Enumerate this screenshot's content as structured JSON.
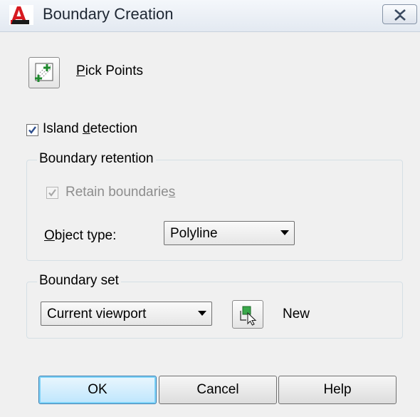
{
  "window": {
    "title": "Boundary Creation",
    "close_label": "Close"
  },
  "pick_points": {
    "label_accel": "P",
    "label_rest": "ick Points"
  },
  "island_detection": {
    "checked": true,
    "label_pre": "Island ",
    "label_accel": "d",
    "label_rest": "etection"
  },
  "boundary_retention": {
    "title": "Boundary retention",
    "retain": {
      "checked": true,
      "enabled": false,
      "label_pre": "Retain boundarie",
      "label_accel": "s"
    },
    "object_type": {
      "label_accel": "O",
      "label_rest": "bject type:",
      "value": "Polyline"
    }
  },
  "boundary_set": {
    "title": "Boundary set",
    "value": "Current viewport",
    "new_label": "New"
  },
  "buttons": {
    "ok": "OK",
    "cancel": "Cancel",
    "help": "Help"
  },
  "colors": {
    "dialog_bg": "#f0f0f0",
    "ok_border": "#3c7fb1",
    "app_icon_red": "#d71920"
  },
  "icons": {
    "app": "autocad-a-icon",
    "pick_points": "pick-points-icon",
    "new_set": "select-objects-icon",
    "close": "close-x-icon",
    "dropdown": "chevron-down-icon"
  }
}
